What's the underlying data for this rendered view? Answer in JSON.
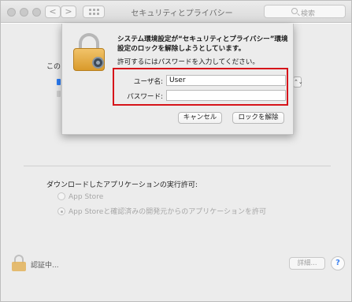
{
  "window": {
    "title": "セキュリティとプライバシー",
    "search_placeholder": "検索",
    "nav_back": "<",
    "nav_forward": ">"
  },
  "background": {
    "partial_heading": "このコ",
    "stepper_symbol": "⌃⌄",
    "download_heading": "ダウンロードしたアプリケーションの実行許可:",
    "download_options": [
      {
        "label": "App Store",
        "selected": false
      },
      {
        "label": "App Storeと確認済みの開発元からのアプリケーションを許可",
        "selected": true
      }
    ],
    "auth_status": "認証中...",
    "details_button": "詳細...",
    "help_button": "?"
  },
  "dialog": {
    "message_bold": "システム環境設定が“セキュリティとプライバシー”環境設定のロックを解除しようとしています。",
    "message": "許可するにはパスワードを入力してください。",
    "username_label": "ユーザ名:",
    "username_value": "User",
    "password_label": "パスワード:",
    "password_value": "",
    "cancel_button": "キャンセル",
    "unlock_button": "ロックを解除"
  },
  "colors": {
    "highlight_border": "#d6141a",
    "accent_blue": "#2b7cf5"
  },
  "icons": [
    "lock-icon",
    "gear-icon",
    "search-icon",
    "grid-icon",
    "help-icon"
  ]
}
